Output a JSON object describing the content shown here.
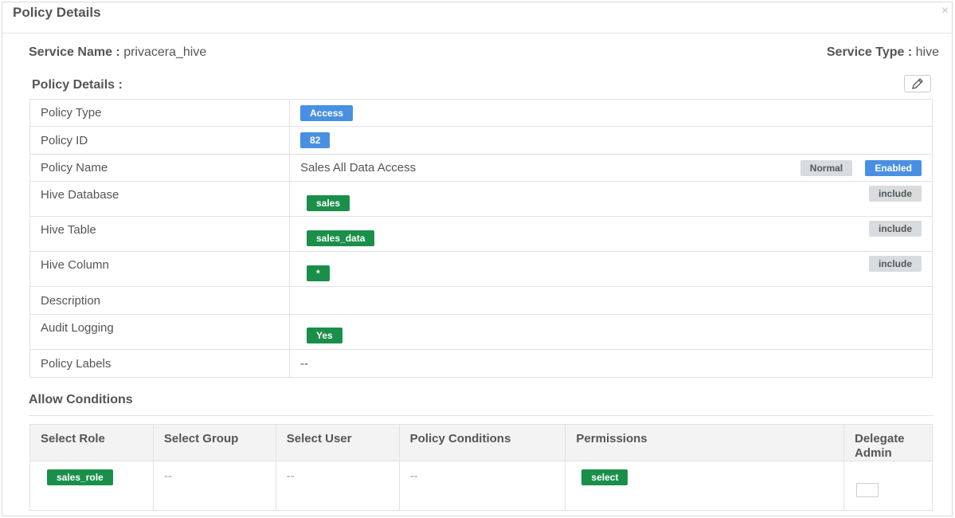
{
  "header": {
    "title": "Policy Details",
    "close_label": "×"
  },
  "service": {
    "name_label": "Service Name :",
    "name_value": "privacera_hive",
    "type_label": "Service Type :",
    "type_value": "hive"
  },
  "details": {
    "title": "Policy Details :",
    "rows": {
      "policy_type": {
        "label": "Policy Type",
        "badge": "Access"
      },
      "policy_id": {
        "label": "Policy ID",
        "badge": "82"
      },
      "policy_name": {
        "label": "Policy Name",
        "value": "Sales All Data Access",
        "priority": "Normal",
        "status": "Enabled"
      },
      "hive_database": {
        "label": "Hive Database",
        "value": "sales",
        "mode": "include"
      },
      "hive_table": {
        "label": "Hive Table",
        "value": "sales_data",
        "mode": "include"
      },
      "hive_column": {
        "label": "Hive Column",
        "value": "*",
        "mode": "include"
      },
      "description": {
        "label": "Description",
        "value": ""
      },
      "audit_logging": {
        "label": "Audit Logging",
        "value": "Yes"
      },
      "policy_labels": {
        "label": "Policy Labels",
        "value": "--"
      }
    }
  },
  "allow": {
    "title": "Allow Conditions",
    "columns": [
      "Select Role",
      "Select Group",
      "Select User",
      "Policy Conditions",
      "Permissions",
      "Delegate Admin"
    ],
    "row": {
      "role": "sales_role",
      "group": "--",
      "user": "--",
      "conditions": "--",
      "permission": "select",
      "delegate_admin": false
    }
  },
  "icons": {
    "edit": "pencil-icon",
    "close": "close-icon"
  },
  "colors": {
    "blue": "#4a90e2",
    "green": "#1a8f4a",
    "grey_badge": "#d8dcde"
  }
}
